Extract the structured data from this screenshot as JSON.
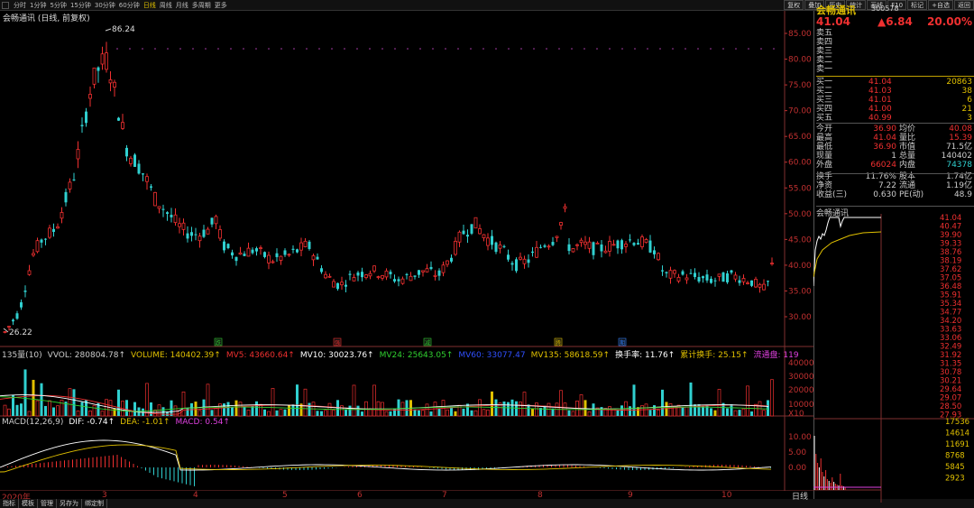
{
  "toolbar": {
    "periods": [
      "分时",
      "1分钟",
      "5分钟",
      "15分钟",
      "30分钟",
      "60分钟",
      "日线",
      "周线",
      "月线",
      "多周期",
      "更多"
    ],
    "active_period": "日线",
    "right_buttons": [
      "复权",
      "叠加",
      "历史",
      "统计",
      "画线",
      "F10",
      "标记",
      "+自选",
      "返回"
    ]
  },
  "chart": {
    "title": "会畅通讯 (日线, 前复权)",
    "max_label": "86.24",
    "min_label": "26.22",
    "price_ticks": [
      "85.00",
      "80.00",
      "75.00",
      "70.00",
      "65.00",
      "60.00",
      "55.00",
      "50.00",
      "45.00",
      "40.00",
      "35.00",
      "30.00"
    ],
    "event_marks": [
      "跌",
      "强",
      "减",
      "腾",
      "期"
    ],
    "vol_ticks": [
      "40000",
      "30000",
      "20000",
      "10000",
      "X10"
    ],
    "macd_ticks": [
      "10.00",
      "5.00",
      "0.00"
    ],
    "dates": [
      "2020年",
      "3",
      "4",
      "5",
      "6",
      "7",
      "8",
      "9",
      "10"
    ]
  },
  "vol_legend": [
    {
      "text": "135量(10)",
      "color": "#cccccc"
    },
    {
      "text": "VVOL: 280804.78↑",
      "color": "#cccccc"
    },
    {
      "text": "VOLUME: 140402.39↑",
      "color": "#e0c000"
    },
    {
      "text": "MV5: 43660.64↑",
      "color": "#f03030"
    },
    {
      "text": "MV10: 30023.76↑",
      "color": "#ffffff"
    },
    {
      "text": "MV24: 25643.05↑",
      "color": "#30d030"
    },
    {
      "text": "MV60: 33077.47",
      "color": "#3050ff"
    },
    {
      "text": "MV135: 58618.59↑",
      "color": "#e0c000"
    },
    {
      "text": "换手率: 11.76↑",
      "color": "#ffffff"
    },
    {
      "text": "累计换手: 25.15↑",
      "color": "#e0c000"
    },
    {
      "text": "流通盘: 119",
      "color": "#e040e0"
    }
  ],
  "macd_legend": [
    {
      "text": "MACD(12,26,9)",
      "color": "#cccccc"
    },
    {
      "text": "DIF: -0.74↑",
      "color": "#ffffff"
    },
    {
      "text": "DEA: -1.01↑",
      "color": "#e0c000"
    },
    {
      "text": "MACD: 0.54↑",
      "color": "#e040e0"
    }
  ],
  "bottom_tabs": [
    "指标",
    "模板",
    "管理",
    "另存为",
    "绑定制"
  ],
  "quote": {
    "name": "会畅通讯",
    "code": "300578",
    "price": "41.04",
    "change": "▲6.84",
    "percent": "20.00%"
  },
  "order_book": {
    "sell": [
      {
        "label": "卖五",
        "price": "",
        "vol": ""
      },
      {
        "label": "卖四",
        "price": "",
        "vol": ""
      },
      {
        "label": "卖三",
        "price": "",
        "vol": ""
      },
      {
        "label": "卖二",
        "price": "",
        "vol": ""
      },
      {
        "label": "卖一",
        "price": "",
        "vol": ""
      }
    ],
    "buy": [
      {
        "label": "买一",
        "price": "41.04",
        "vol": "20863"
      },
      {
        "label": "买二",
        "price": "41.03",
        "vol": "38"
      },
      {
        "label": "买三",
        "price": "41.01",
        "vol": "6"
      },
      {
        "label": "买四",
        "price": "41.00",
        "vol": "21"
      },
      {
        "label": "买五",
        "price": "40.99",
        "vol": "3"
      }
    ]
  },
  "stats": [
    {
      "l1": "今开",
      "v1": "36.90",
      "c1": "#f03030",
      "l2": "均价",
      "v2": "40.08",
      "c2": "#f03030"
    },
    {
      "l1": "最高",
      "v1": "41.04",
      "c1": "#f03030",
      "l2": "量比",
      "v2": "15.39",
      "c2": "#f03030"
    },
    {
      "l1": "最低",
      "v1": "36.90",
      "c1": "#f03030",
      "l2": "市值",
      "v2": "71.5亿",
      "c2": "#cccccc"
    },
    {
      "l1": "现量",
      "v1": "1",
      "c1": "#cccccc",
      "l2": "总量",
      "v2": "140402",
      "c2": "#cccccc"
    },
    {
      "l1": "外盘",
      "v1": "66024",
      "c1": "#f03030",
      "l2": "内盘",
      "v2": "74378",
      "c2": "#30d0d0"
    },
    {
      "l1": "换手",
      "v1": "11.76%",
      "c1": "#cccccc",
      "l2": "股本",
      "v2": "1.74亿",
      "c2": "#cccccc"
    },
    {
      "l1": "净资",
      "v1": "7.22",
      "c1": "#cccccc",
      "l2": "流通",
      "v2": "1.19亿",
      "c2": "#cccccc"
    },
    {
      "l1": "收益(三)",
      "v1": "0.630",
      "c1": "#cccccc",
      "l2": "PE(动)",
      "v2": "48.9",
      "c2": "#cccccc"
    }
  ],
  "mini": {
    "name": "会畅通讯",
    "price_ticks": [
      "41.04",
      "40.47",
      "39.90",
      "39.33",
      "38.76",
      "38.19",
      "37.62",
      "37.05",
      "36.48",
      "35.91",
      "35.34",
      "34.77",
      "34.20",
      "33.63",
      "33.06",
      "32.49",
      "31.92",
      "31.35",
      "30.78",
      "30.21",
      "29.64",
      "29.07",
      "28.50",
      "27.93"
    ],
    "vol_ticks": [
      "17536",
      "14614",
      "11691",
      "8768",
      "5845",
      "2923"
    ],
    "period": "日线"
  },
  "colors": {
    "up": "#f03030",
    "down": "#30d0d0",
    "gold": "#e0c000"
  }
}
